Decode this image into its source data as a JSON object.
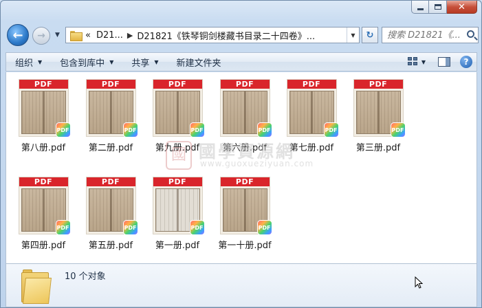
{
  "window": {
    "caption_buttons": {
      "minimize": "minimize",
      "maximize": "maximize",
      "close": "✕"
    }
  },
  "nav": {
    "back_glyph": "←",
    "forward_glyph": "→",
    "address": {
      "overflow": "«",
      "crumb1": "D21...",
      "crumb2": "D21821《铁琴铜剑楼藏书目录二十四卷》..."
    },
    "search_placeholder": "搜索 D21821《...",
    "refresh_glyph": "↻"
  },
  "toolbar": {
    "organize": "组织",
    "include_in_library": "包含到库中",
    "share": "共享",
    "new_folder": "新建文件夹",
    "help": "?"
  },
  "files": [
    {
      "name": "第八册.pdf",
      "banner": "PDF",
      "scan": "dark"
    },
    {
      "name": "第二册.pdf",
      "banner": "PDF",
      "scan": "dark"
    },
    {
      "name": "第九册.pdf",
      "banner": "PDF",
      "scan": "dark"
    },
    {
      "name": "第六册.pdf",
      "banner": "PDF",
      "scan": "dark"
    },
    {
      "name": "第七册.pdf",
      "banner": "PDF",
      "scan": "dark"
    },
    {
      "name": "第三册.pdf",
      "banner": "PDF",
      "scan": "dark"
    },
    {
      "name": "第四册.pdf",
      "banner": "PDF",
      "scan": "dark"
    },
    {
      "name": "第五册.pdf",
      "banner": "PDF",
      "scan": "dark"
    },
    {
      "name": "第一册.pdf",
      "banner": "PDF",
      "scan": "light"
    },
    {
      "name": "第一十册.pdf",
      "banner": "PDF",
      "scan": "dark"
    }
  ],
  "badge_label": "PDF",
  "watermark": {
    "seal": "國",
    "title": "國學資源網",
    "url": "www.guoxueziyuan.com"
  },
  "status": {
    "count": "10 个对象"
  }
}
